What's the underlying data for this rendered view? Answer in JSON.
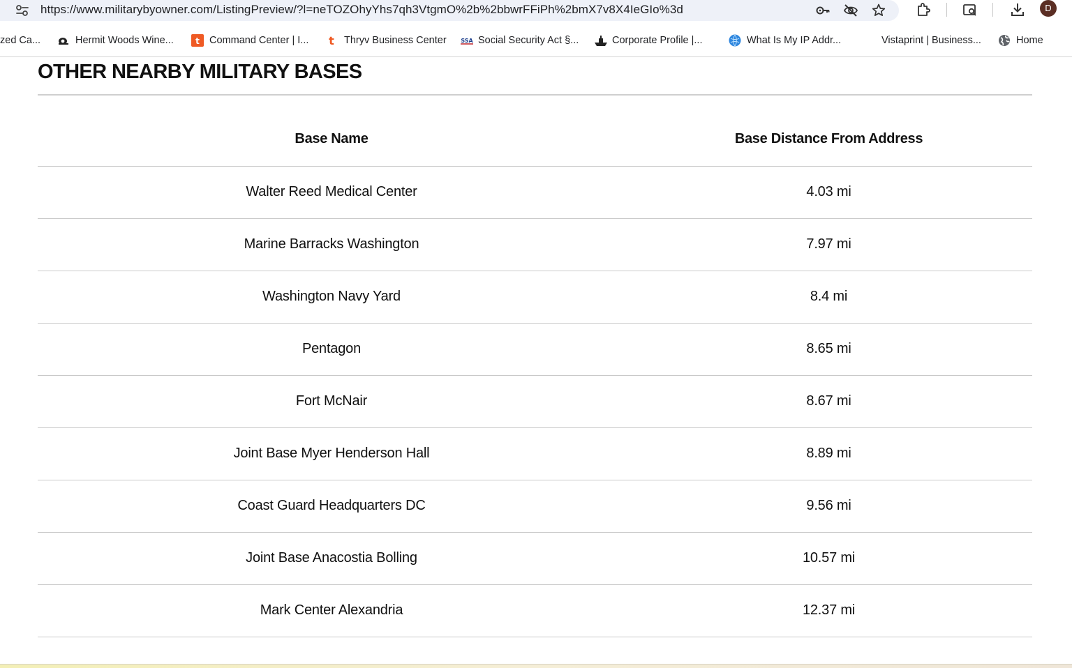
{
  "browser": {
    "url": "https://www.militarybyowner.com/ListingPreview/?l=neTOZOhyYhs7qh3VtgmO%2b%2bbwrFFiPh%2bmX7v8X4IeGIo%3d",
    "avatar_letter": "D",
    "accent_color": "#eef1f8"
  },
  "bookmarks": [
    {
      "label": "zed Ca...",
      "icon": "none"
    },
    {
      "label": "Hermit Woods Wine...",
      "icon": "snail-icon"
    },
    {
      "label": "Command Center | I...",
      "icon": "thryv-orange-icon"
    },
    {
      "label": "Thryv Business Center",
      "icon": "thryv-t-icon"
    },
    {
      "label": "Social Security Act §...",
      "icon": "ssa-icon"
    },
    {
      "label": "Corporate Profile |...",
      "icon": "ship-icon"
    },
    {
      "label": "What Is My IP Addr...",
      "icon": "globe-blue-icon"
    },
    {
      "label": "Vistaprint | Business...",
      "icon": "none"
    },
    {
      "label": "Home",
      "icon": "globe-gray-icon"
    }
  ],
  "section": {
    "title": "OTHER NEARBY MILITARY BASES"
  },
  "table": {
    "headers": [
      "Base Name",
      "Base Distance From Address"
    ],
    "rows": [
      {
        "name": "Walter Reed Medical Center",
        "distance": "4.03 mi"
      },
      {
        "name": "Marine Barracks Washington",
        "distance": "7.97 mi"
      },
      {
        "name": "Washington Navy Yard",
        "distance": "8.4 mi"
      },
      {
        "name": "Pentagon",
        "distance": "8.65 mi"
      },
      {
        "name": "Fort McNair",
        "distance": "8.67 mi"
      },
      {
        "name": "Joint Base Myer Henderson Hall",
        "distance": "8.89 mi"
      },
      {
        "name": "Coast Guard Headquarters DC",
        "distance": "9.56 mi"
      },
      {
        "name": "Joint Base Anacostia Bolling",
        "distance": "10.57 mi"
      },
      {
        "name": "Mark Center Alexandria",
        "distance": "12.37 mi"
      }
    ]
  }
}
